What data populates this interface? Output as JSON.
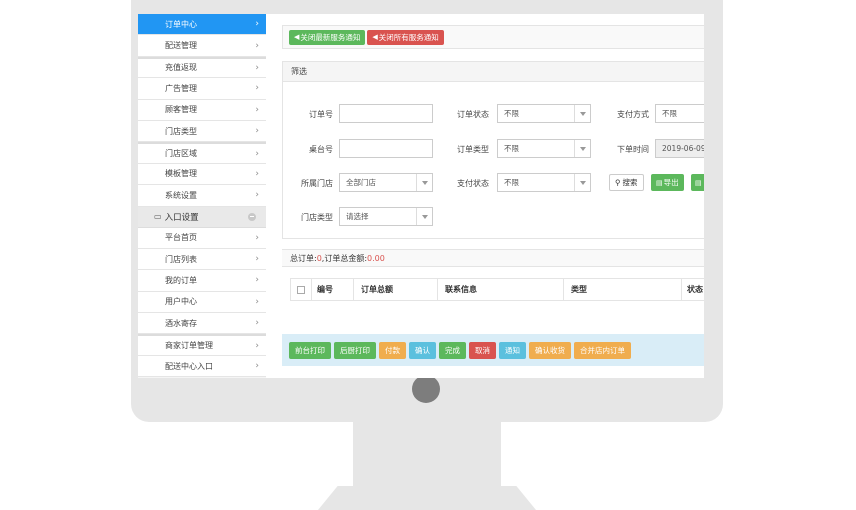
{
  "sidebar": {
    "items": [
      {
        "label": "订单中心",
        "active": true
      },
      {
        "label": "配送管理"
      },
      {
        "label": "充值返现"
      },
      {
        "label": "广告管理"
      },
      {
        "label": "顾客管理"
      },
      {
        "label": "门店类型"
      },
      {
        "label": "门店区域"
      },
      {
        "label": "模板管理"
      },
      {
        "label": "系统设置"
      }
    ],
    "section_header": "入口设置",
    "section_items": [
      {
        "label": "平台首页"
      },
      {
        "label": "门店列表"
      },
      {
        "label": "我的订单"
      },
      {
        "label": "用户中心"
      },
      {
        "label": "酒水寄存"
      },
      {
        "label": "商家订单管理"
      },
      {
        "label": "配送中心入口"
      }
    ],
    "chevron": "›"
  },
  "notices": {
    "close_latest": "关闭最新服务通知",
    "close_all": "关闭所有服务通知"
  },
  "filter": {
    "title": "筛选",
    "order_no_label": "订单号",
    "order_status_label": "订单状态",
    "order_status_value": "不限",
    "pay_method_label": "支付方式",
    "pay_method_value": "不限",
    "table_no_label": "桌台号",
    "order_type_label": "订单类型",
    "order_type_value": "不限",
    "order_time_label": "下单时间",
    "order_time_value": "2019-06-09",
    "store_label": "所属门店",
    "store_value": "全部门店",
    "pay_status_label": "支付状态",
    "pay_status_value": "不限",
    "search_label": "搜索",
    "export_label": "导出",
    "store_type_label": "门店类型",
    "store_type_value": "请选择"
  },
  "summary": {
    "total_orders_label": "总订单:",
    "total_orders_value": "0",
    "total_amount_label": " ,订单总金额:",
    "total_amount_value": "0.00"
  },
  "table": {
    "columns": [
      "编号",
      "订单总额",
      "联系信息",
      "类型",
      "状态"
    ]
  },
  "actions": [
    {
      "label": "前台打印",
      "color": "green"
    },
    {
      "label": "后厨打印",
      "color": "green"
    },
    {
      "label": "付款",
      "color": "orange"
    },
    {
      "label": "确认",
      "color": "blue"
    },
    {
      "label": "完成",
      "color": "green"
    },
    {
      "label": "取消",
      "color": "red"
    },
    {
      "label": "通知",
      "color": "blue"
    },
    {
      "label": "确认收货",
      "color": "orange"
    },
    {
      "label": "合并店内订单",
      "color": "orange"
    }
  ],
  "colors": {
    "accent": "#2196f3",
    "green": "#5cb85c",
    "red": "#d9534f",
    "orange": "#f0ad4e",
    "blue": "#5bc0de"
  }
}
